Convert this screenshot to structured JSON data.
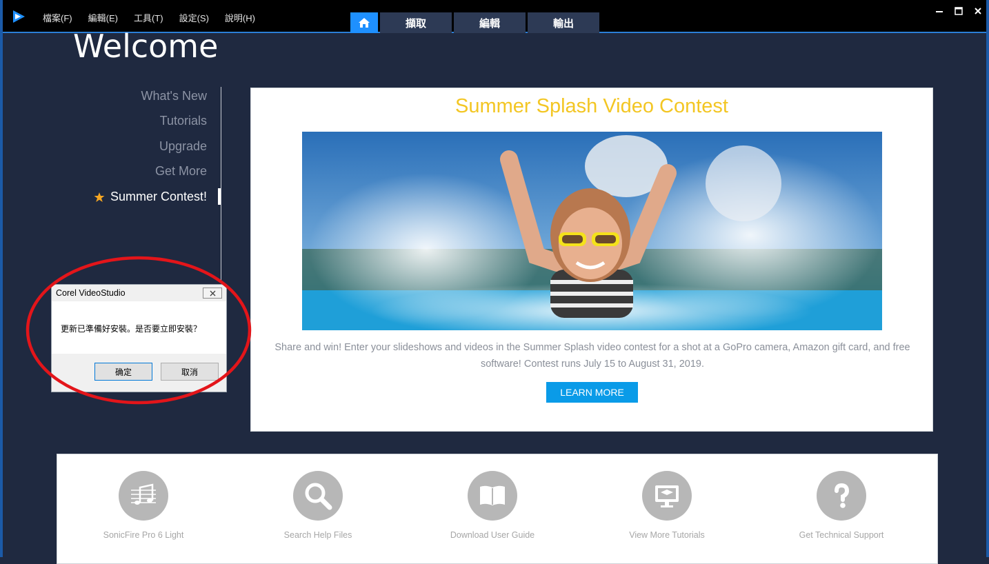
{
  "menu": [
    "檔案(F)",
    "編輯(E)",
    "工具(T)",
    "設定(S)",
    "說明(H)"
  ],
  "tabs": {
    "capture": "擷取",
    "edit": "編輯",
    "share": "輸出"
  },
  "welcome": "Welcome",
  "sidebar": {
    "items": [
      {
        "label": "What's New",
        "active": false
      },
      {
        "label": "Tutorials",
        "active": false
      },
      {
        "label": "Upgrade",
        "active": false
      },
      {
        "label": "Get More",
        "active": false
      },
      {
        "label": "Summer Contest!",
        "active": true,
        "icon": "star-icon"
      }
    ]
  },
  "contest": {
    "title": "Summer Splash Video Contest",
    "description": "Share and win! Enter your slideshows and videos in the Summer Splash video contest for a shot at a GoPro camera, Amazon gift card, and free software! Contest runs July 15 to August 31, 2019.",
    "button": "LEARN MORE"
  },
  "dialog": {
    "title": "Corel VideoStudio",
    "message": "更新已準備好安裝。是否要立即安裝？",
    "ok": "确定",
    "cancel": "取消"
  },
  "resources": [
    {
      "label": "SonicFire Pro 6 Light",
      "icon": "music-notes-icon"
    },
    {
      "label": "Search Help Files",
      "icon": "magnifier-icon"
    },
    {
      "label": "Download User Guide",
      "icon": "book-icon"
    },
    {
      "label": "View More Tutorials",
      "icon": "monitor-graduation-icon"
    },
    {
      "label": "Get Technical Support",
      "icon": "question-icon"
    }
  ],
  "colors": {
    "background": "#1f2940",
    "accent": "#1e90ff",
    "contest_title": "#f3c623",
    "annotation": "#e3151a"
  }
}
